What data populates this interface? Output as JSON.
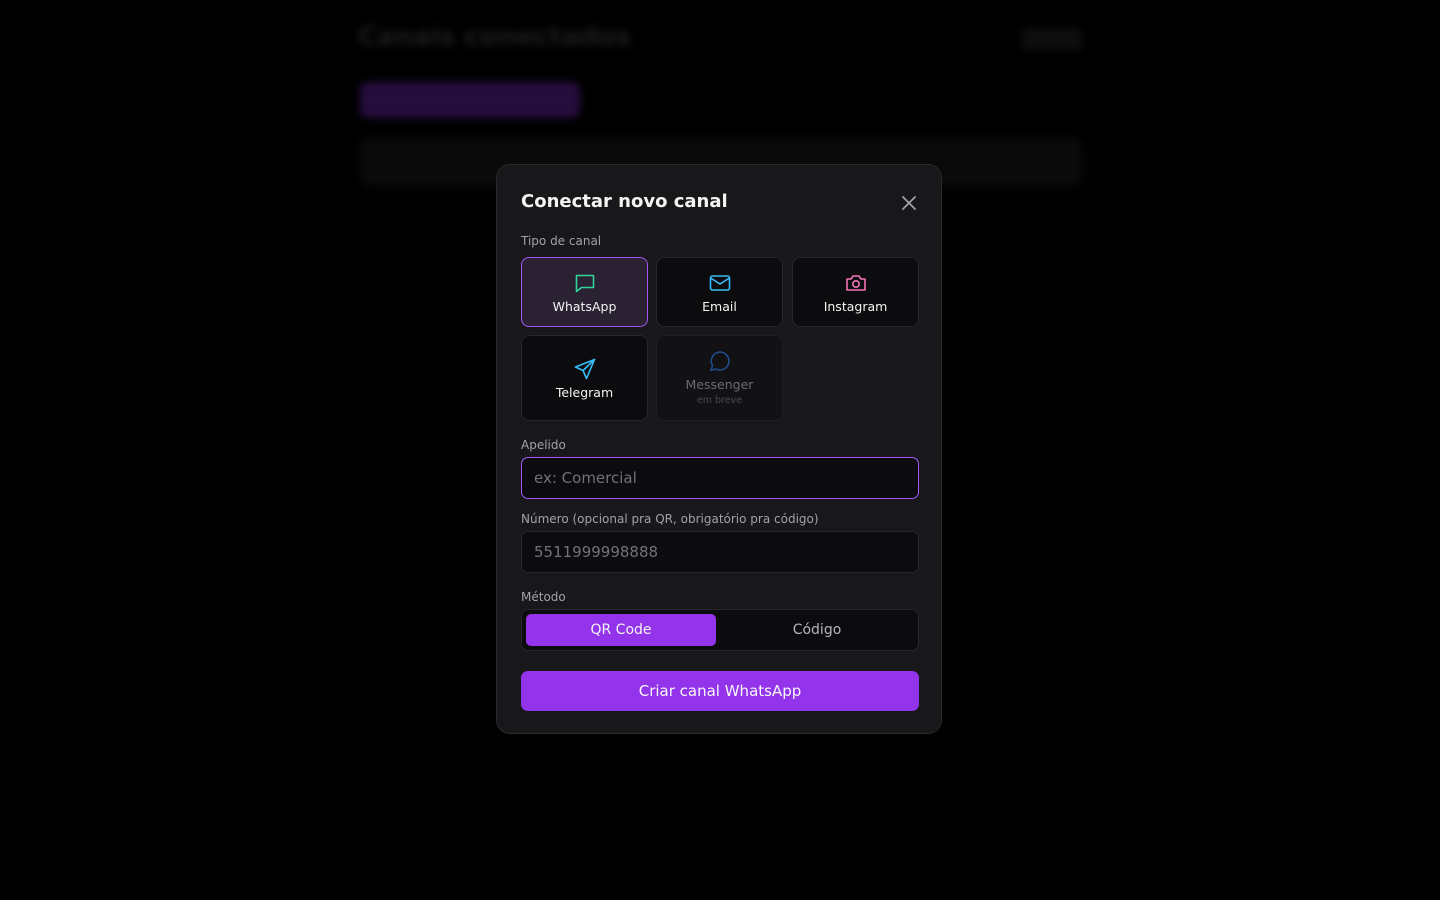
{
  "background": {
    "page_title": "Canais conectados"
  },
  "modal": {
    "title": "Conectar novo canal",
    "channel_type_label": "Tipo de canal",
    "channel_types": [
      {
        "label": "WhatsApp",
        "icon": "message-square-icon",
        "color": "#34d399",
        "selected": true,
        "disabled": false
      },
      {
        "label": "Email",
        "icon": "mail-icon",
        "color": "#38bdf8",
        "selected": false,
        "disabled": false
      },
      {
        "label": "Instagram",
        "icon": "camera-icon",
        "color": "#f472b6",
        "selected": false,
        "disabled": false
      },
      {
        "label": "Telegram",
        "icon": "send-icon",
        "color": "#38bdf8",
        "selected": false,
        "disabled": false
      },
      {
        "label": "Messenger",
        "sublabel": "em breve",
        "icon": "message-circle-icon",
        "color": "#1e4d8c",
        "selected": false,
        "disabled": true
      }
    ],
    "nickname": {
      "label": "Apelido",
      "value": "",
      "placeholder": "ex: Comercial"
    },
    "number": {
      "label": "Número (opcional pra QR, obrigatório pra código)",
      "value": "",
      "placeholder": "5511999998888"
    },
    "method": {
      "label": "Método",
      "options": [
        "QR Code",
        "Código"
      ],
      "selected": "QR Code"
    },
    "submit_label": "Criar canal WhatsApp"
  },
  "colors": {
    "accent": "#9333ea",
    "accent_border": "#a855f7"
  }
}
